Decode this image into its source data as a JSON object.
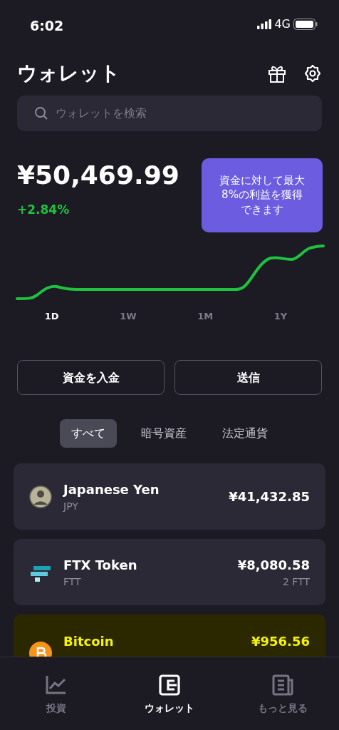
{
  "status_bar": {
    "time": "6:02",
    "network": "4G"
  },
  "header": {
    "title": "ウォレット"
  },
  "search": {
    "placeholder": "ウォレットを検索"
  },
  "balance": {
    "amount": "¥50,469.99",
    "change": "+2.84%"
  },
  "promo": {
    "text": "資金に対して最大8%の利益を獲得できます"
  },
  "ranges": [
    {
      "label": "1D",
      "selected": true
    },
    {
      "label": "1W",
      "selected": false
    },
    {
      "label": "1M",
      "selected": false
    },
    {
      "label": "1Y",
      "selected": false
    }
  ],
  "actions": [
    "資金を入金",
    "送信"
  ],
  "filters": [
    {
      "label": "すべて",
      "selected": true
    },
    {
      "label": "暗号資産",
      "selected": false
    },
    {
      "label": "法定通貨",
      "selected": false
    }
  ],
  "assets": [
    {
      "name": "Japanese Yen",
      "symbol": "JPY",
      "value": "¥41,432.85",
      "highlighted": false
    },
    {
      "name": "FTX Token",
      "symbol": "FTT",
      "value": "¥8,080.58",
      "amount": "2 FTT",
      "highlighted": false
    },
    {
      "name": "Bitcoin",
      "value": "¥956.56",
      "highlighted": true
    }
  ],
  "tab_bar": [
    {
      "label": "投資",
      "selected": false
    },
    {
      "label": "ウォレット",
      "selected": true
    },
    {
      "label": "もっと見る",
      "selected": false
    }
  ]
}
